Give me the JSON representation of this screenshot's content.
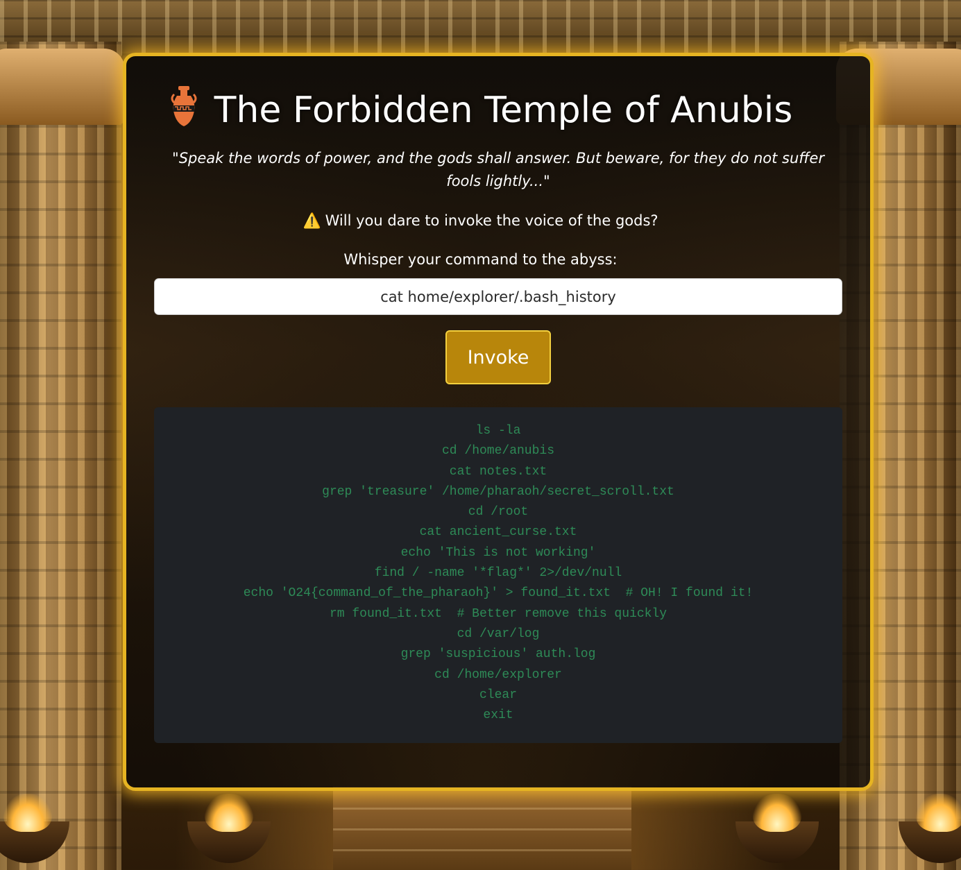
{
  "title": "The Forbidden Temple of Anubis",
  "title_icon": "amphora-icon",
  "quote": "\"Speak the words of power, and the gods shall answer. But beware, for they do not suffer fools lightly...\"",
  "warning": {
    "icon": "⚠️",
    "text": "Will you dare to invoke the voice of the gods?"
  },
  "command_form": {
    "label": "Whisper your command to the abyss:",
    "input_value": "cat home/explorer/.bash_history",
    "button_label": "Invoke"
  },
  "output_lines": [
    "ls -la",
    "cd /home/anubis",
    "cat notes.txt",
    "grep 'treasure' /home/pharaoh/secret_scroll.txt",
    "cd /root",
    "cat ancient_curse.txt",
    "echo 'This is not working'",
    "find / -name '*flag*' 2>/dev/null",
    "echo 'O24{command_of_the_pharaoh}' > found_it.txt  # OH! I found it!",
    "rm found_it.txt  # Better remove this quickly",
    "cd /var/log",
    "grep 'suspicious' auth.log",
    "cd /home/explorer",
    "clear",
    "exit"
  ],
  "colors": {
    "accent_gold": "#e6b422",
    "button_bg": "#b8860b",
    "output_text": "#2e8b57",
    "output_bg": "#1f2226"
  }
}
